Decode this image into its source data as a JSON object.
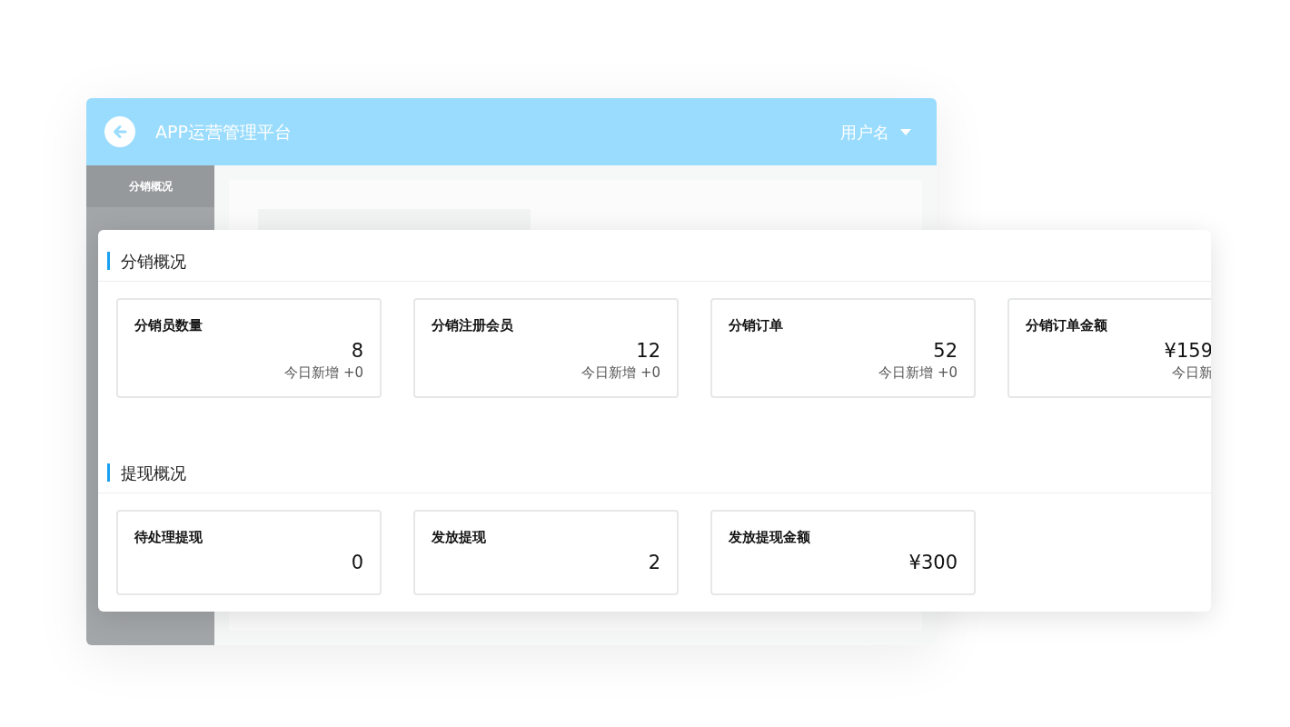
{
  "header": {
    "title": "APP运营管理平台",
    "user": "用户名"
  },
  "sidebar": {
    "items": [
      {
        "label": "分销概况",
        "selected": true
      }
    ]
  },
  "sections": [
    {
      "title": "分销概况",
      "cards": [
        {
          "label": "分销员数量",
          "value": "8",
          "today": "今日新增 +0",
          "cut": false
        },
        {
          "label": "分销注册会员",
          "value": "12",
          "today": "今日新增 +0",
          "cut": false
        },
        {
          "label": "分销订单",
          "value": "52",
          "today": "今日新增 +0",
          "cut": false
        },
        {
          "label": "分销订单金额",
          "value": "¥159",
          "today": "今日新",
          "cut": true
        }
      ]
    },
    {
      "title": "提现概况",
      "cards": [
        {
          "label": "待处理提现",
          "value": "0",
          "cut": false
        },
        {
          "label": "发放提现",
          "value": "2",
          "cut": false
        },
        {
          "label": "发放提现金额",
          "value": "¥300",
          "cut": false
        }
      ]
    }
  ]
}
